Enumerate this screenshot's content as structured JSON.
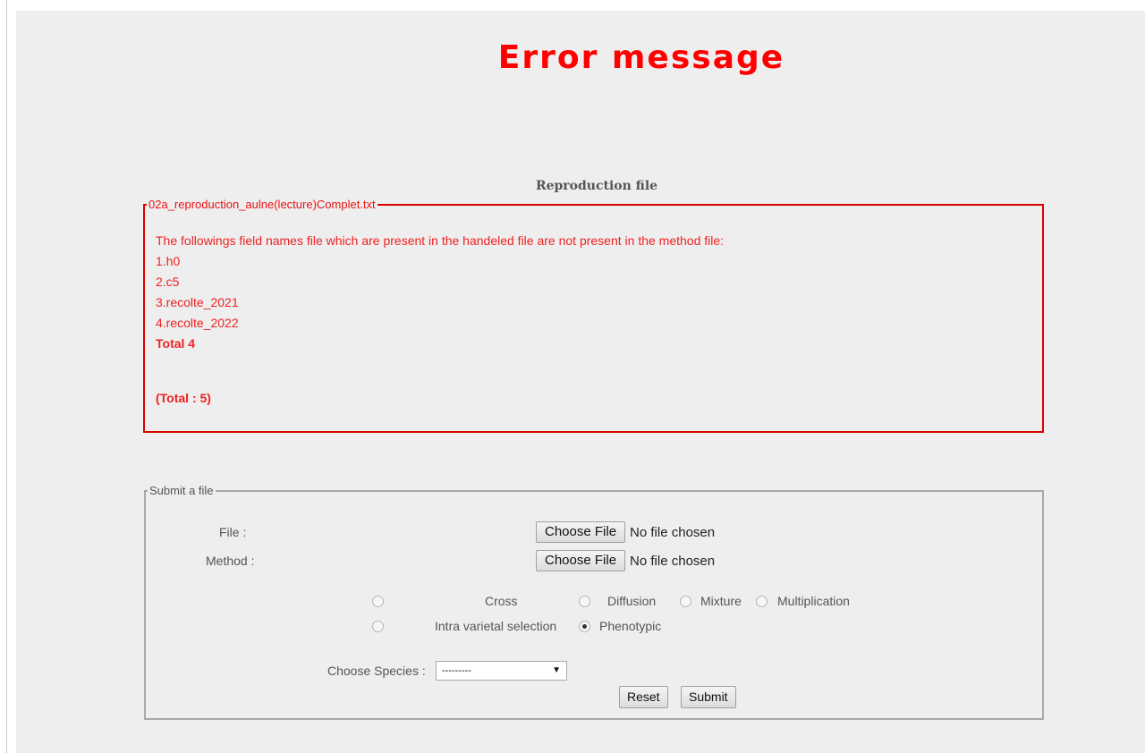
{
  "title": "Error message",
  "section_label": "Reproduction file",
  "error_box": {
    "legend": "02a_reproduction_aulne(lecture)Complet.txt",
    "message": "The followings field names file which are present in the handeled file are not present in the method file:",
    "items": [
      "1.h0",
      "2.c5",
      "3.recolte_2021",
      "4.recolte_2022"
    ],
    "total": "Total 4",
    "grand_total": "(Total : 5)"
  },
  "form": {
    "legend": "Submit a file",
    "file_label": "File :",
    "method_label": "Method :",
    "choose_file_label": "Choose File",
    "no_file_text": "No file chosen",
    "radios": [
      {
        "label": "Cross",
        "checked": false
      },
      {
        "label": "Diffusion",
        "checked": false
      },
      {
        "label": "Mixture",
        "checked": false
      },
      {
        "label": "Multiplication",
        "checked": false
      },
      {
        "label": "Intra varietal selection",
        "checked": false
      },
      {
        "label": "Phenotypic",
        "checked": true
      }
    ],
    "species_label": "Choose Species :",
    "species_selected": "---------",
    "reset_label": "Reset",
    "submit_label": "Submit"
  },
  "colors": {
    "error_red": "#ee2222",
    "title_red": "#ff0000",
    "background": "#eeeeee"
  }
}
